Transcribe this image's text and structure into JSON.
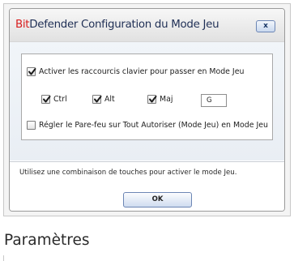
{
  "dialog": {
    "title_brand": "Bit",
    "title_rest": "Defender Configuration du Mode Jeu",
    "close_label": "x",
    "shortcuts": {
      "enable_label": "Activer les raccourcis clavier pour passer en Mode Jeu",
      "enable_checked": true,
      "ctrl_label": "Ctrl",
      "ctrl_checked": true,
      "alt_label": "Alt",
      "alt_checked": true,
      "maj_label": "Maj",
      "maj_checked": true,
      "key_value": "G"
    },
    "firewall": {
      "label": "Régler le Pare-feu sur Tout Autoriser (Mode Jeu) en Mode Jeu",
      "checked": false
    },
    "info_text": "Utilisez une combinaison de touches pour activer le mode Jeu.",
    "ok_label": "OK"
  },
  "caption": "Paramètres",
  "colors": {
    "brand_red": "#d81e1e",
    "title_text": "#1f2f55",
    "button_border": "#6c86b4"
  }
}
